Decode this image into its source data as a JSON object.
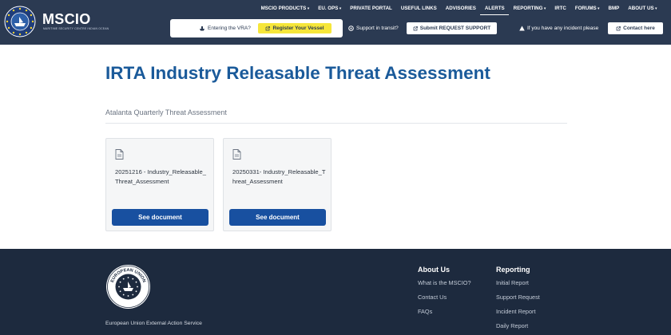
{
  "header": {
    "brand": "MSCIO",
    "brand_sub": "MARITIME SECURITY CENTRE INDIAN OCEAN",
    "nav": [
      {
        "label": "MSCIO PRODUCTS",
        "dropdown": true
      },
      {
        "label": "EU. OPS",
        "dropdown": true
      },
      {
        "label": "PRIVATE PORTAL",
        "dropdown": false
      },
      {
        "label": "USEFUL LINKS",
        "dropdown": false
      },
      {
        "label": "ADVISORIES",
        "dropdown": false
      },
      {
        "label": "ALERTS",
        "dropdown": false,
        "active": true
      },
      {
        "label": "REPORTING",
        "dropdown": true
      },
      {
        "label": "IRTC",
        "dropdown": false
      },
      {
        "label": "FORUMS",
        "dropdown": true
      },
      {
        "label": "BMP",
        "dropdown": false
      },
      {
        "label": "ABOUT US",
        "dropdown": true
      }
    ],
    "vra_question": "Entering the VRA?",
    "vra_button": "Register Your Vessel",
    "transit_question": "Support in transit?",
    "support_button": "Submit REQUEST SUPPORT",
    "incident_text": "If you have any incident please",
    "contact_button": "Contact here",
    "colors": {
      "header_bg": "#2b3a52",
      "vra_button_bg": "#f6e63a"
    }
  },
  "main": {
    "title": "IRTA Industry Releasable Threat Assessment",
    "subtitle": "Atalanta Quarterly Threat Assessment",
    "documents": [
      {
        "name": "20251216 - Industry_Releasable_Threat_Assessment",
        "button": "See document"
      },
      {
        "name": "20250331- Industry_Releasable_Threat_Assessment",
        "button": "See document"
      }
    ],
    "colors": {
      "title": "#1a5a9a",
      "button_bg": "#1850a0"
    }
  },
  "footer": {
    "org": "European Union External Action Service",
    "seal_text": "EUROPEAN UNION",
    "columns": [
      {
        "heading": "About Us",
        "links": [
          "What is the MSCIO?",
          "Contact Us",
          "FAQs"
        ]
      },
      {
        "heading": "Reporting",
        "links": [
          "Initial Report",
          "Support Request",
          "Incident Report",
          "Daily Report"
        ]
      }
    ],
    "colors": {
      "footer_bg": "#1d2a3e"
    }
  }
}
